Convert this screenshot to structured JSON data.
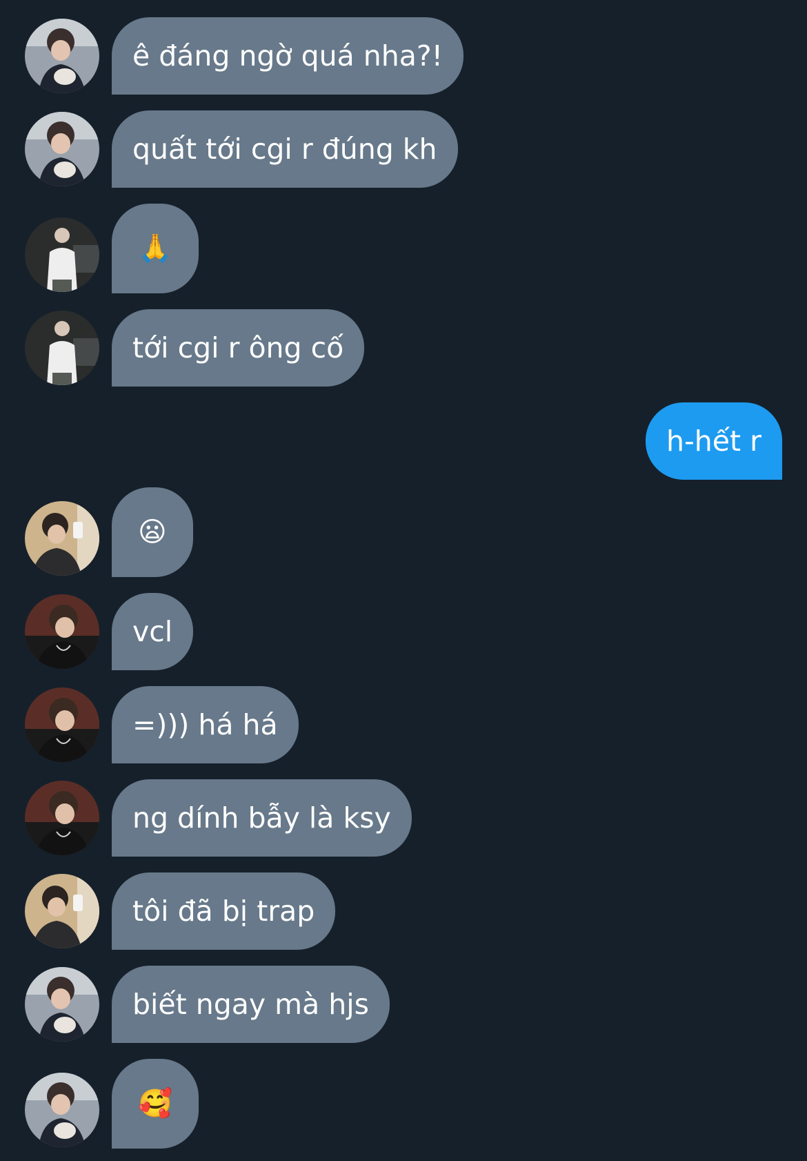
{
  "colors": {
    "background": "#16202b",
    "incoming_bubble": "#67798a",
    "outgoing_bubble": "#1d9bf0",
    "text": "#ffffff"
  },
  "messages": [
    {
      "direction": "incoming",
      "avatar": "avatar-a",
      "text": "ê đáng ngờ quá nha?!"
    },
    {
      "direction": "incoming",
      "avatar": "avatar-a",
      "text": "quất tới cgi r đúng kh"
    },
    {
      "direction": "incoming",
      "avatar": "avatar-b",
      "text": "🙏"
    },
    {
      "direction": "incoming",
      "avatar": "avatar-b",
      "text": "tới cgi r ông cố"
    },
    {
      "direction": "outgoing",
      "text": "h-hết r"
    },
    {
      "direction": "incoming",
      "avatar": "avatar-c",
      "text": "😦"
    },
    {
      "direction": "incoming",
      "avatar": "avatar-d",
      "text": "vcl"
    },
    {
      "direction": "incoming",
      "avatar": "avatar-d",
      "text": "=))) há há"
    },
    {
      "direction": "incoming",
      "avatar": "avatar-d",
      "text": "ng dính bẫy là ksy"
    },
    {
      "direction": "incoming",
      "avatar": "avatar-c",
      "text": "tôi đã bị trap"
    },
    {
      "direction": "incoming",
      "avatar": "avatar-a",
      "text": "biết ngay mà hjs"
    },
    {
      "direction": "incoming",
      "avatar": "avatar-a",
      "text": "🥰"
    }
  ]
}
